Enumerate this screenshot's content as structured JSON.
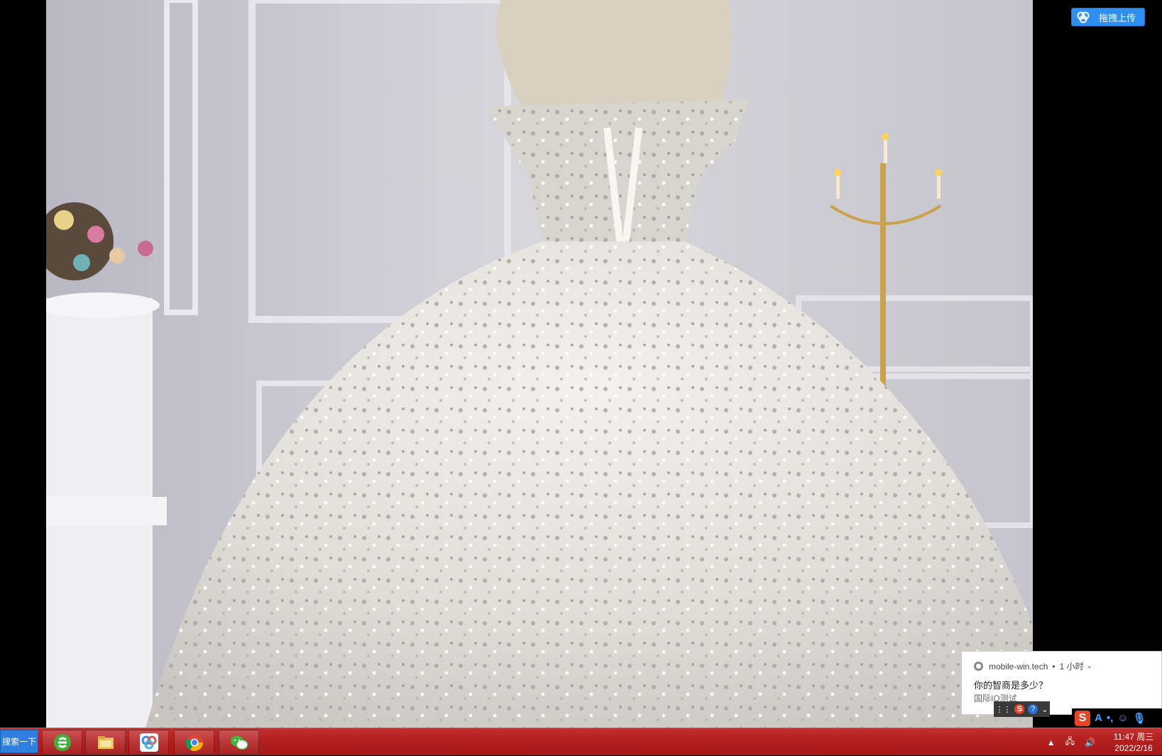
{
  "upload": {
    "label": "拖拽上传"
  },
  "notification": {
    "source": "mobile-win.tech",
    "time": "1 小时",
    "title": "你的智商是多少？",
    "body": "国际IQ测试"
  },
  "ime": {
    "logo": "S",
    "mode": "A"
  },
  "taskbar": {
    "search_label": "搜索一下",
    "apps": [
      "ie-browser",
      "file-explorer",
      "baidu-netdisk",
      "chrome",
      "wechat"
    ]
  },
  "clock": {
    "time": "11:47 周三",
    "date": "2022/2/16"
  },
  "colors": {
    "taskbar": "#b21f1f",
    "accent": "#2f8ff0"
  }
}
